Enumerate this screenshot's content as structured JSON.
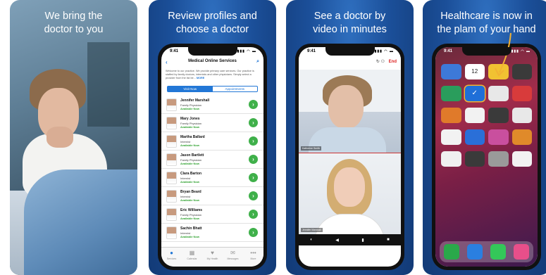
{
  "panels": [
    {
      "caption_line1": "We bring the",
      "caption_line2": "doctor to you"
    },
    {
      "caption_line1": "Review profiles and",
      "caption_line2": "choose a doctor"
    },
    {
      "caption_line1": "See a doctor by",
      "caption_line2": "video in minutes"
    },
    {
      "caption_line1": "Healthcare is now in",
      "caption_line2": "the plam of your hand"
    }
  ],
  "phone": {
    "time": "9:41"
  },
  "app": {
    "nav_title": "Medical Online Services",
    "intro": "Welcome to our practice. We provide primary care services. Our practice is staffed by family doctors, internists and other physicians. Simply select a provider from the list be...",
    "intro_more": "MORE",
    "tabs": {
      "visit_now": "Visit Now",
      "appointments": "Appointments"
    },
    "doctors": [
      {
        "name": "Jennifer Marshall",
        "specialty": "Family Physician",
        "status": "Available Now"
      },
      {
        "name": "Mary Jones",
        "specialty": "Family Physician",
        "status": "Available Now"
      },
      {
        "name": "Martha Ballard",
        "specialty": "Internist",
        "status": "Available Now"
      },
      {
        "name": "Jason Bartlett",
        "specialty": "Family Physician",
        "status": "Available Now"
      },
      {
        "name": "Clara Barton",
        "specialty": "Internist",
        "status": "Available Now"
      },
      {
        "name": "Bryan Beard",
        "specialty": "Internist",
        "status": "Available Now"
      },
      {
        "name": "Eric Williams",
        "specialty": "Family Physician",
        "status": "Available Now"
      },
      {
        "name": "Sachin Bhatt",
        "specialty": "Internist",
        "status": "Available Now"
      }
    ],
    "tabbar": [
      {
        "label": "Services",
        "icon": "person-icon"
      },
      {
        "label": "Calendar",
        "icon": "calendar-icon"
      },
      {
        "label": "My Health",
        "icon": "heart-icon"
      },
      {
        "label": "Messages",
        "icon": "envelope-icon"
      },
      {
        "label": "More",
        "icon": "more-dots-icon"
      }
    ]
  },
  "video": {
    "end_label": "End",
    "patient_label": "Katherine Smith",
    "doctor_label": "Jennifer Marshall"
  },
  "home": {
    "calendar_day": "12",
    "app_colors": [
      "#3d79d8",
      "#ffffff",
      "#f1c232",
      "#3a3a3a",
      "#2a9d5c",
      "#1f6fd8",
      "#e8e8e8",
      "#d83b3b",
      "#e07a2a",
      "#f2f2f2",
      "#3a3a3a",
      "#e8e8e8",
      "#f2f2f2",
      "#2a6fd8",
      "#c94f9e",
      "#e08a2a",
      "#f0f0f0",
      "#3a3a3a",
      "#9a9a9a",
      "#f2f2f2"
    ],
    "dock_colors": [
      "#2aa84a",
      "#2a7fe0",
      "#34c759",
      "#e84f8a"
    ]
  }
}
